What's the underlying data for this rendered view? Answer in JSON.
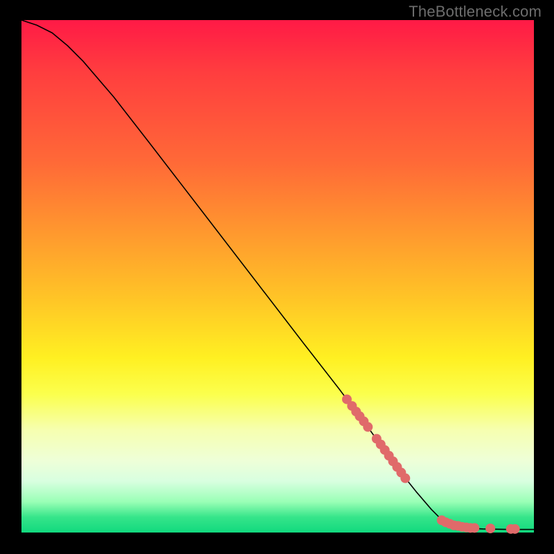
{
  "watermark": "TheBottleneck.com",
  "chart_data": {
    "type": "line",
    "title": "",
    "xlabel": "",
    "ylabel": "",
    "xlim": [
      0,
      100
    ],
    "ylim": [
      0,
      100
    ],
    "gradient_stops": [
      {
        "pos": 0,
        "color": "#ff1a46"
      },
      {
        "pos": 10,
        "color": "#ff3d3f"
      },
      {
        "pos": 28,
        "color": "#ff6a37"
      },
      {
        "pos": 42,
        "color": "#ff9a2e"
      },
      {
        "pos": 55,
        "color": "#ffc726"
      },
      {
        "pos": 66,
        "color": "#fff022"
      },
      {
        "pos": 73,
        "color": "#fbff4d"
      },
      {
        "pos": 80,
        "color": "#f6ffb0"
      },
      {
        "pos": 86,
        "color": "#eeffd8"
      },
      {
        "pos": 90,
        "color": "#d8ffe0"
      },
      {
        "pos": 94,
        "color": "#9affb6"
      },
      {
        "pos": 97,
        "color": "#36e58a"
      },
      {
        "pos": 100,
        "color": "#11d97e"
      }
    ],
    "curve": [
      {
        "x": 0,
        "y": 100
      },
      {
        "x": 3,
        "y": 99
      },
      {
        "x": 6,
        "y": 97.5
      },
      {
        "x": 9,
        "y": 95
      },
      {
        "x": 12,
        "y": 92
      },
      {
        "x": 18,
        "y": 85
      },
      {
        "x": 25,
        "y": 76
      },
      {
        "x": 35,
        "y": 63
      },
      {
        "x": 45,
        "y": 50
      },
      {
        "x": 55,
        "y": 37
      },
      {
        "x": 62,
        "y": 28
      },
      {
        "x": 68,
        "y": 20
      },
      {
        "x": 73,
        "y": 13
      },
      {
        "x": 77,
        "y": 8
      },
      {
        "x": 80,
        "y": 4.5
      },
      {
        "x": 82,
        "y": 2.5
      },
      {
        "x": 84,
        "y": 1.4
      },
      {
        "x": 86,
        "y": 0.9
      },
      {
        "x": 90,
        "y": 0.7
      },
      {
        "x": 95,
        "y": 0.6
      },
      {
        "x": 100,
        "y": 0.6
      }
    ],
    "highlight_points": [
      {
        "x": 63.5,
        "y": 26.0
      },
      {
        "x": 64.5,
        "y": 24.7
      },
      {
        "x": 65.3,
        "y": 23.6
      },
      {
        "x": 66.0,
        "y": 22.7
      },
      {
        "x": 66.8,
        "y": 21.7
      },
      {
        "x": 67.6,
        "y": 20.6
      },
      {
        "x": 69.3,
        "y": 18.3
      },
      {
        "x": 70.1,
        "y": 17.2
      },
      {
        "x": 70.9,
        "y": 16.1
      },
      {
        "x": 71.7,
        "y": 15.0
      },
      {
        "x": 72.5,
        "y": 13.9
      },
      {
        "x": 73.3,
        "y": 12.8
      },
      {
        "x": 74.1,
        "y": 11.7
      },
      {
        "x": 74.9,
        "y": 10.6
      },
      {
        "x": 82.0,
        "y": 2.4
      },
      {
        "x": 82.8,
        "y": 2.0
      },
      {
        "x": 83.6,
        "y": 1.7
      },
      {
        "x": 84.4,
        "y": 1.4
      },
      {
        "x": 85.2,
        "y": 1.3
      },
      {
        "x": 86.0,
        "y": 1.1
      },
      {
        "x": 86.8,
        "y": 1.0
      },
      {
        "x": 87.6,
        "y": 0.9
      },
      {
        "x": 88.4,
        "y": 0.9
      },
      {
        "x": 91.5,
        "y": 0.8
      },
      {
        "x": 95.5,
        "y": 0.7
      },
      {
        "x": 96.3,
        "y": 0.7
      }
    ],
    "highlight_color": "#e06a6a",
    "highlight_radius": 7
  }
}
